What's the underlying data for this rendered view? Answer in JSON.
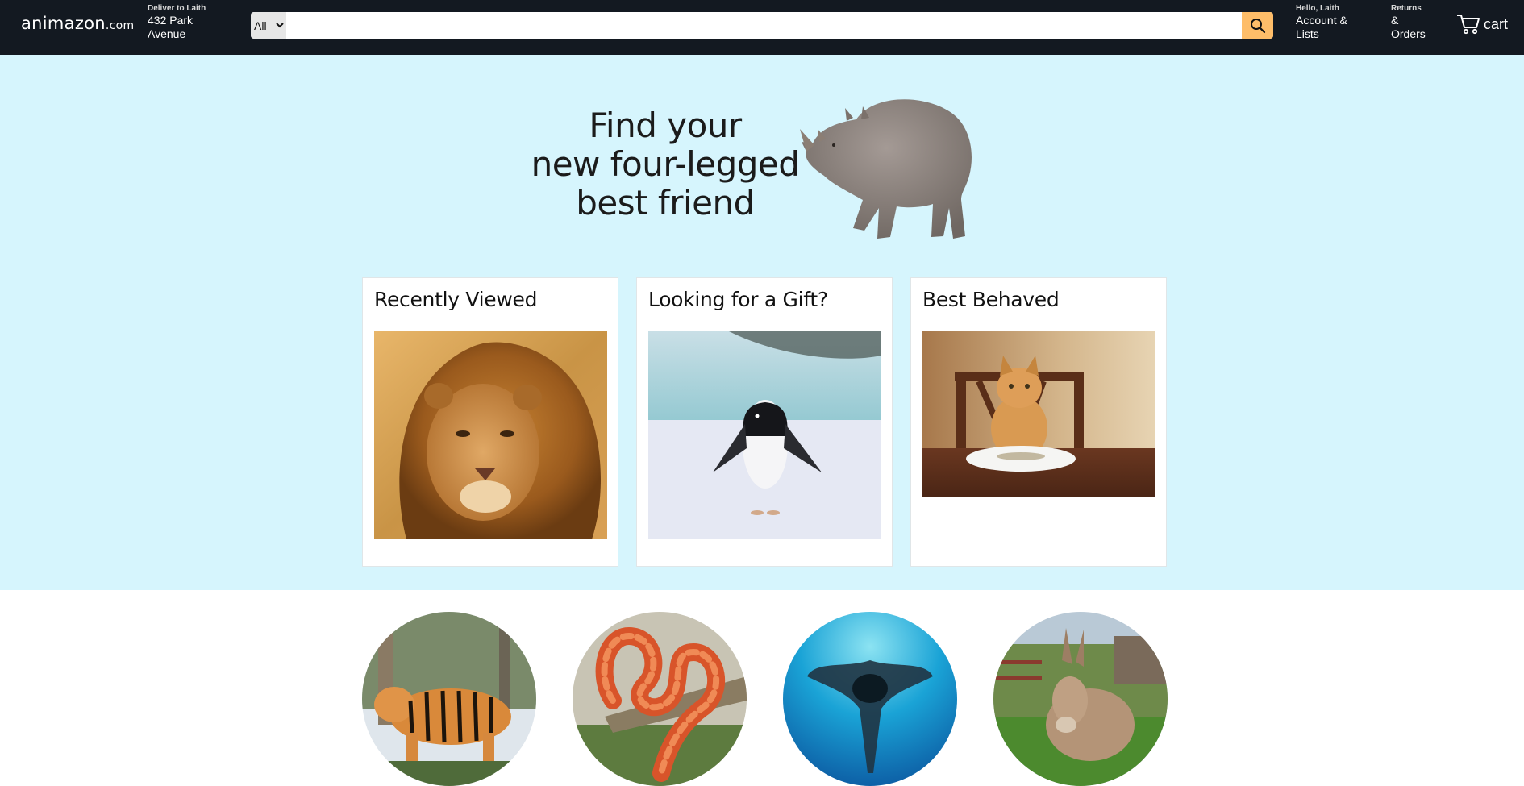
{
  "brand": {
    "name": "animazon",
    "suffix": ".com"
  },
  "deliver": {
    "line1": "Deliver to Laith",
    "line2": "432 Park",
    "line3": "Avenue"
  },
  "search": {
    "category": "All",
    "placeholder": "",
    "value": ""
  },
  "account": {
    "line1": "Hello, Laith",
    "line2": "Account &",
    "line3": "Lists"
  },
  "returns": {
    "line1": "Returns",
    "line2": "&",
    "line3": "Orders"
  },
  "cart": {
    "label": "cart"
  },
  "hero": {
    "line1": "Find your",
    "line2": "new four-legged",
    "line3": "best friend"
  },
  "cards": [
    {
      "title": "Recently Viewed",
      "image": "lion"
    },
    {
      "title": "Looking for a Gift?",
      "image": "penguin"
    },
    {
      "title": "Best Behaved",
      "image": "cat"
    }
  ],
  "categories": [
    "tiger",
    "snake",
    "manta-ray",
    "donkey"
  ],
  "colors": {
    "nav": "#131921",
    "accent": "#febd69",
    "hero": "#d6f5fd"
  }
}
